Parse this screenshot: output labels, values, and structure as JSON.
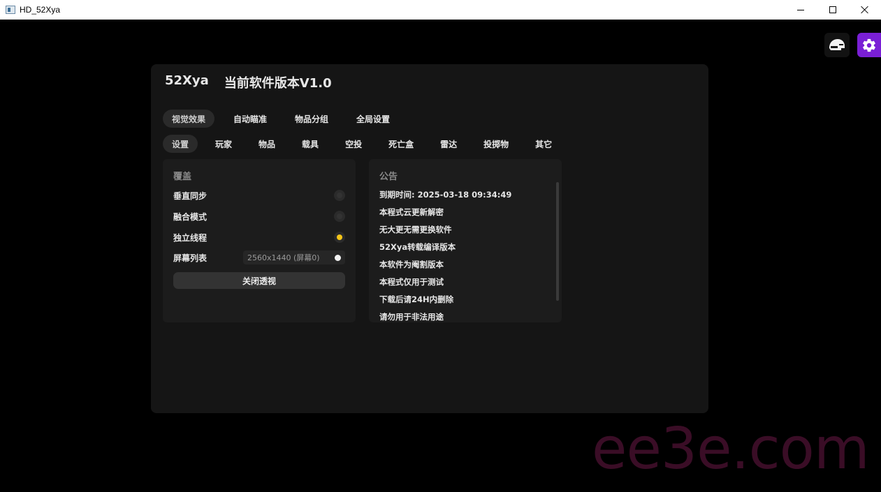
{
  "window": {
    "title": "HD_52Xya"
  },
  "toolbar": {
    "helmet_icon": "helmet-icon",
    "settings_icon": "gear-icon",
    "settings_color": "#7a1fd6"
  },
  "header": {
    "brand": "52Xya",
    "version_text": "当前软件版本V1.0"
  },
  "main_tabs": [
    {
      "label": "视觉效果",
      "active": true
    },
    {
      "label": "自动瞄准",
      "active": false
    },
    {
      "label": "物品分组",
      "active": false
    },
    {
      "label": "全局设置",
      "active": false
    }
  ],
  "sub_tabs": [
    {
      "label": "设置",
      "active": true
    },
    {
      "label": "玩家",
      "active": false
    },
    {
      "label": "物品",
      "active": false
    },
    {
      "label": "载具",
      "active": false
    },
    {
      "label": "空投",
      "active": false
    },
    {
      "label": "死亡盒",
      "active": false
    },
    {
      "label": "雷达",
      "active": false
    },
    {
      "label": "投掷物",
      "active": false
    },
    {
      "label": "其它",
      "active": false
    }
  ],
  "overlay": {
    "title": "覆盖",
    "options": [
      {
        "label": "垂直同步",
        "enabled": false
      },
      {
        "label": "融合模式",
        "enabled": false
      },
      {
        "label": "独立线程",
        "enabled": true
      }
    ],
    "screen_list": {
      "label": "屏幕列表",
      "value": "2560x1440 (屏幕0)"
    },
    "close_button": "关闭透视",
    "accent_color": "#f5c518"
  },
  "notice": {
    "title": "公告",
    "items": [
      "到期时间: 2025-03-18 09:34:49",
      "本程式云更新解密",
      "无大更无需更换软件",
      "52Xya转载编译版本",
      "本软件为阉割版本",
      "本程式仅用于测试",
      "下载后请24H内删除",
      "请勿用于非法用途"
    ]
  },
  "watermark": "ee3e.com"
}
